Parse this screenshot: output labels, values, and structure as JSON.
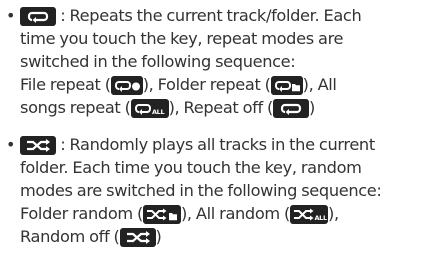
{
  "items": [
    {
      "icon": "repeat-icon",
      "lines": [
        ": Repeats the current track/folder. Each",
        "time you touch the key, repeat modes are",
        "switched in the following sequence:"
      ],
      "line4": {
        "a": "File repeat (",
        "b": "), Folder repeat (",
        "c": "), All"
      },
      "line5": {
        "a": "songs repeat (",
        "b": "), Repeat off (",
        "c": ")"
      },
      "icons": [
        "repeat-file-icon",
        "repeat-folder-icon",
        "repeat-all-icon",
        "repeat-off-icon"
      ]
    },
    {
      "icon": "shuffle-icon",
      "lines": [
        ": Randomly plays all tracks in the current",
        "folder. Each time you touch the key, random",
        "modes are switched in the following sequence:"
      ],
      "line4": {
        "a": "Folder random (",
        "b": "), All random (",
        "c": "),"
      },
      "line5": {
        "a": "Random off (",
        "b": ")"
      },
      "icons": [
        "random-folder-icon",
        "random-all-icon",
        "random-off-icon"
      ]
    }
  ],
  "bullet_char": "•",
  "badge_text": {
    "all": "ALL"
  },
  "colors": {
    "text": "#333333",
    "key_bg": "#222222",
    "key_fg": "#ffffff"
  }
}
